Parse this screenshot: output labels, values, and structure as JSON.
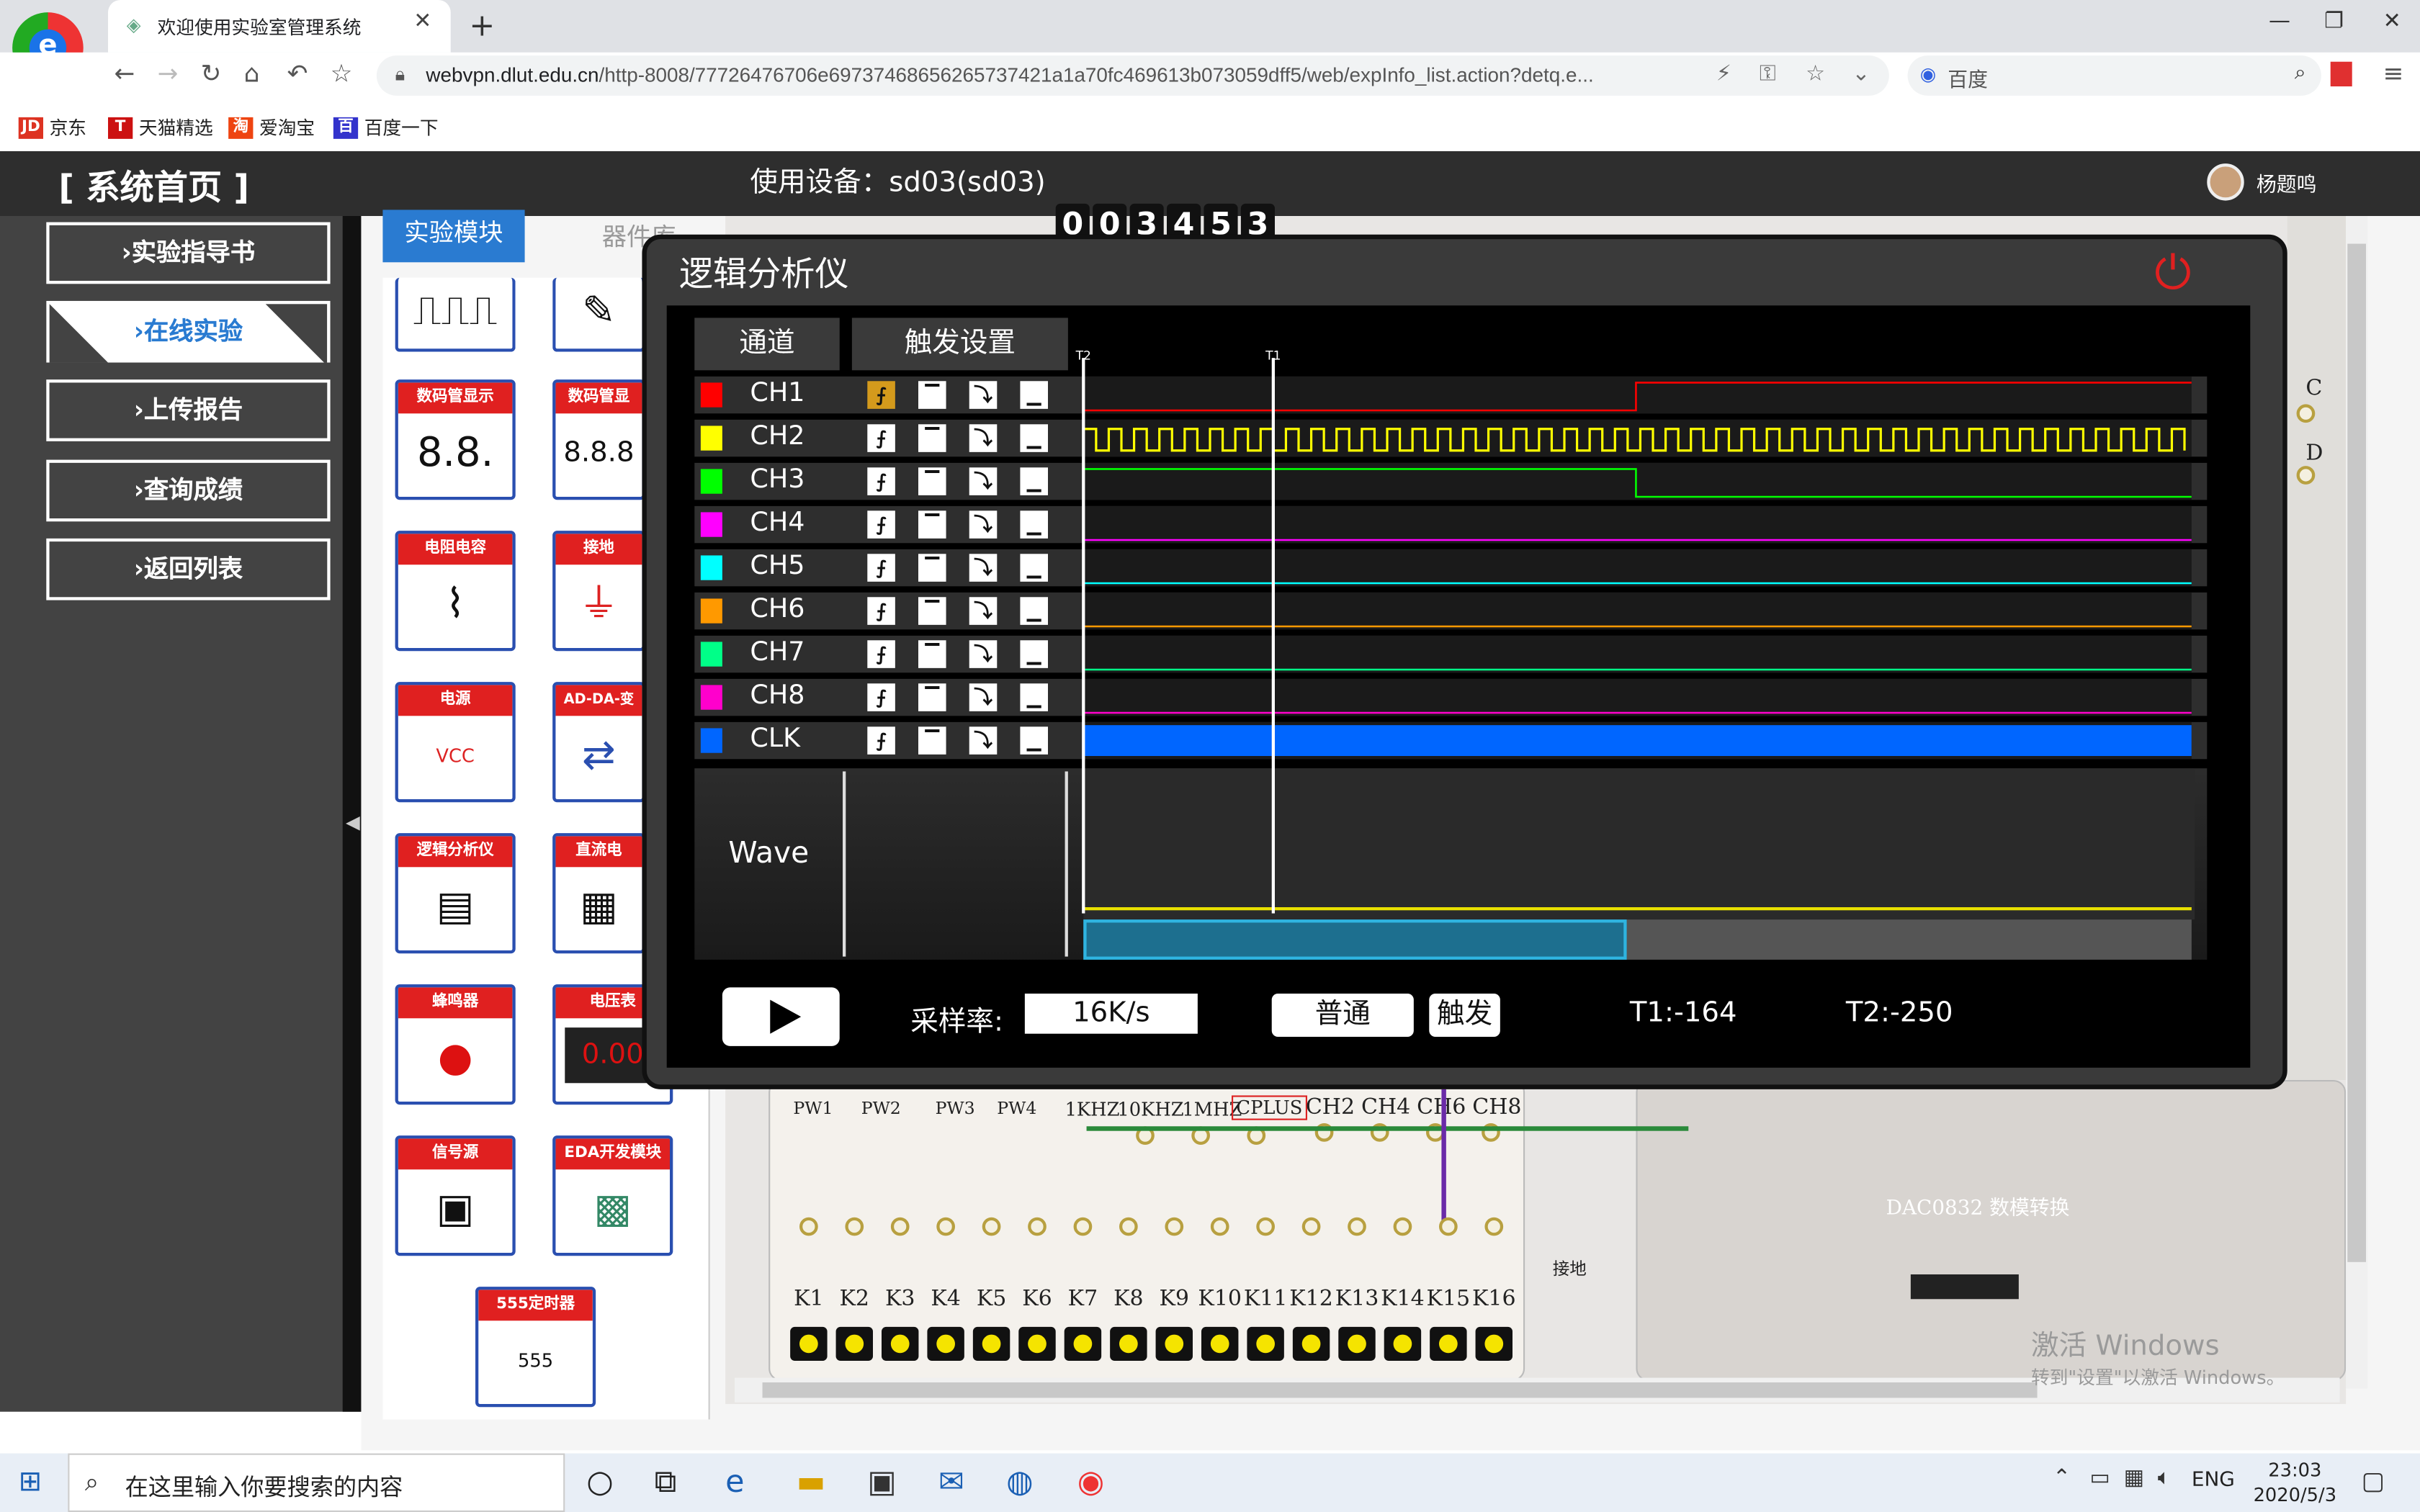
{
  "browser": {
    "tab_title": "欢迎使用实验室管理系统",
    "url_domain": "webvpn.dlut.edu.cn",
    "url_path": "/http-8008/77726476706e69737468656265737421a1a70fc469613b073059dff5/web/expInfo_list.action?detq.e...",
    "search_engine": "百度",
    "bookmarks": [
      "京东",
      "天猫精选",
      "爱淘宝",
      "百度一下"
    ]
  },
  "header": {
    "home_label": "[ 系统首页 ]",
    "device_label": "使用设备：sd03(sd03)",
    "user_name": "杨题鸣"
  },
  "sidebar": {
    "items": [
      {
        "label": "›实验指导书"
      },
      {
        "label": "›在线实验"
      },
      {
        "label": "›上传报告"
      },
      {
        "label": "›查询成绩"
      },
      {
        "label": "›返回列表"
      }
    ],
    "active_index": 1
  },
  "module_tabs": {
    "experiment": "实验模块",
    "library": "器件库"
  },
  "modules": [
    {
      "title": "数码管显示",
      "glyph": "8.8."
    },
    {
      "title": "数码管显",
      "glyph": "8.8.8"
    },
    {
      "title": "电阻电容",
      "glyph": "⌇"
    },
    {
      "title": "接地",
      "glyph": "⏚"
    },
    {
      "title": "电源",
      "glyph": "VCC"
    },
    {
      "title": "AD-DA-变",
      "glyph": "⇄"
    },
    {
      "title": "逻辑分析仪",
      "glyph": "▤"
    },
    {
      "title": "直流电",
      "glyph": "▦"
    },
    {
      "title": "蜂鸣器",
      "glyph": "●"
    },
    {
      "title": "电压表",
      "glyph": "0.00"
    },
    {
      "title": "信号源",
      "glyph": "▣"
    },
    {
      "title": "EDA开发模块",
      "glyph": "▩"
    },
    {
      "title": "555定时器",
      "glyph": "555"
    }
  ],
  "counter": [
    "0",
    "0",
    "3",
    "4",
    "5",
    "3"
  ],
  "analyzer": {
    "title": "逻辑分析仪",
    "col_channel": "通道",
    "col_trigger": "触发设置",
    "marker_t2": "T2",
    "marker_t1": "T1",
    "channels": [
      {
        "name": "CH1",
        "color": "#ff0000",
        "trigger": "rising"
      },
      {
        "name": "CH2",
        "color": "#ffff00",
        "trigger": "none"
      },
      {
        "name": "CH3",
        "color": "#00ff00",
        "trigger": "none"
      },
      {
        "name": "CH4",
        "color": "#ff00ff",
        "trigger": "none"
      },
      {
        "name": "CH5",
        "color": "#00ffff",
        "trigger": "none"
      },
      {
        "name": "CH6",
        "color": "#ff9900",
        "trigger": "none"
      },
      {
        "name": "CH7",
        "color": "#00ff88",
        "trigger": "none"
      },
      {
        "name": "CH8",
        "color": "#ff00cc",
        "trigger": "none"
      },
      {
        "name": "CLK",
        "color": "#0066ff",
        "trigger": "none"
      }
    ],
    "wave_label": "Wave",
    "rate_label": "采样率:",
    "rate_value": "16K/s",
    "mode_normal": "普通",
    "mode_trigger": "触发",
    "t1": "T1:-164",
    "t2": "T2:-250",
    "view_window_fraction": 0.49
  },
  "board": {
    "pw_labels": [
      "PW1",
      "PW2",
      "PW3",
      "PW4"
    ],
    "freq_labels": [
      "1KHZ",
      "10KHZ",
      "1MHZ",
      "CPLUS"
    ],
    "probe_labels": [
      "CH2",
      "CH4",
      "CH6",
      "CH8"
    ],
    "switch_labels": [
      "K1",
      "K2",
      "K3",
      "K4",
      "K5",
      "K6",
      "K7",
      "K8",
      "K9",
      "K10",
      "K11",
      "K12",
      "K13",
      "K14",
      "K15",
      "K16"
    ],
    "dac_label": "DAC0832 数模转换",
    "ground_label": "接地",
    "side_labels": [
      "C",
      "D"
    ]
  },
  "watermark": {
    "line1": "激活 Windows",
    "line2": "转到\"设置\"以激活 Windows。"
  },
  "taskbar": {
    "search_placeholder": "在这里输入你要搜索的内容",
    "lang": "ENG",
    "time": "23:03",
    "date": "2020/5/3"
  }
}
